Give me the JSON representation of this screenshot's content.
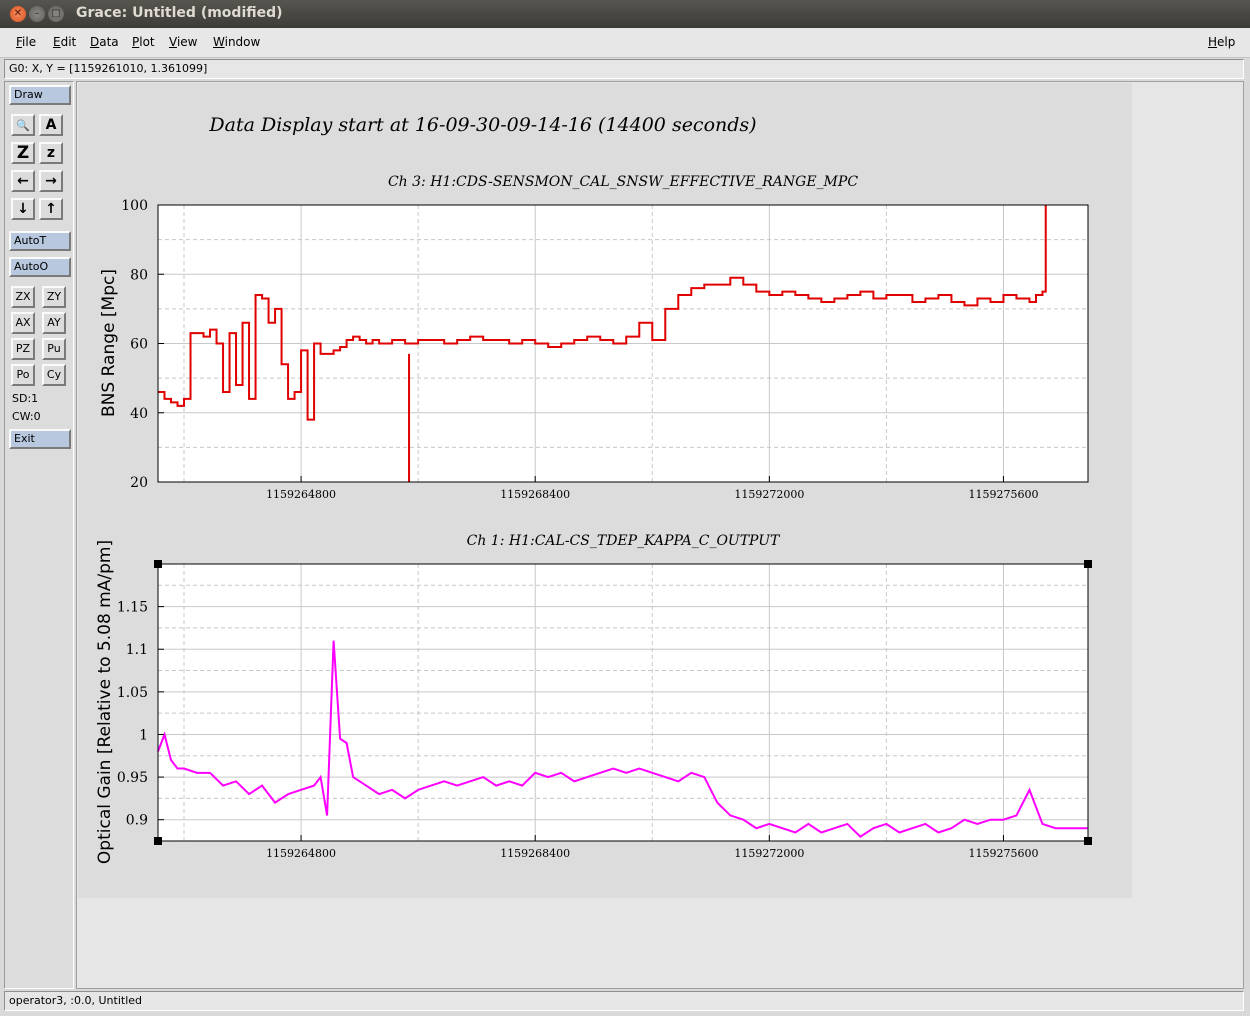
{
  "window": {
    "title": "Grace: Untitled (modified)",
    "close_glyph": "✕",
    "min_glyph": "–",
    "max_glyph": "□"
  },
  "menu": {
    "file": "File",
    "edit": "Edit",
    "data": "Data",
    "plot": "Plot",
    "view": "View",
    "window": "Window",
    "help": "Help"
  },
  "locator": {
    "text": "G0: X, Y = [1159261010, 1.361099]"
  },
  "toolbar": {
    "draw": "Draw",
    "icons": [
      "zoom-icon",
      "text-icon",
      "zoom-x-icon",
      "zoom-y-icon",
      "arrow-left-icon",
      "arrow-right-icon",
      "arrow-down-icon",
      "arrow-up-icon"
    ],
    "icon_glyphs": [
      "🔍",
      "A",
      "Z",
      "z",
      "←",
      "→",
      "↓",
      "↑"
    ],
    "autot": "AutoT",
    "autoo": "AutoO",
    "zx": "ZX",
    "zy": "ZY",
    "ax": "AX",
    "ay": "AY",
    "pz": "PZ",
    "pu": "Pu",
    "po": "Po",
    "cy": "Cy",
    "sd": "SD:1",
    "cw": "CW:0",
    "exit": "Exit"
  },
  "statusbar": {
    "text": "operator3, :0.0, Untitled"
  },
  "colors": {
    "series_range": "#e00000",
    "series_gain": "#ff00ff",
    "grid": "#c8c8c8"
  },
  "chart_data": [
    {
      "type": "line",
      "title": "Data Display start at 16-09-30-09-14-16 (14400 seconds)",
      "subtitle": "Ch 3: H1:CDS-SENSMON_CAL_SNSW_EFFECTIVE_RANGE_MPC",
      "ylabel": "BNS Range [Mpc]",
      "xlabel": "",
      "xlim": [
        1159262600,
        1159276900
      ],
      "ylim": [
        20,
        100
      ],
      "yticks": [
        20,
        40,
        60,
        80,
        100
      ],
      "xticks": [
        1159264800,
        1159268400,
        1159272000,
        1159275600
      ],
      "xtick_labels": [
        "1159264800",
        "1159268400",
        "1159272000",
        "1159275600"
      ],
      "ytick_labels": [
        "20",
        "40",
        "60",
        "80",
        "100"
      ],
      "grid": true,
      "step": true,
      "x": [
        1159262600,
        1159262700,
        1159262800,
        1159262900,
        1159263000,
        1159263100,
        1159263200,
        1159263300,
        1159263400,
        1159263500,
        1159263600,
        1159263700,
        1159263800,
        1159263900,
        1159264000,
        1159264100,
        1159264200,
        1159264300,
        1159264400,
        1159264500,
        1159264600,
        1159264700,
        1159264800,
        1159264900,
        1159265000,
        1159265100,
        1159265200,
        1159265300,
        1159265400,
        1159265500,
        1159265600,
        1159265700,
        1159265800,
        1159265900,
        1159266000,
        1159266200,
        1159266400,
        1159266600,
        1159266800,
        1159267000,
        1159267200,
        1159267400,
        1159267600,
        1159267800,
        1159268000,
        1159268200,
        1159268400,
        1159268600,
        1159268800,
        1159269000,
        1159269200,
        1159269400,
        1159269600,
        1159269800,
        1159270000,
        1159270200,
        1159270400,
        1159270600,
        1159270800,
        1159271000,
        1159271200,
        1159271400,
        1159271600,
        1159271800,
        1159272000,
        1159272200,
        1159272400,
        1159272600,
        1159272800,
        1159273000,
        1159273200,
        1159273400,
        1159273600,
        1159273800,
        1159274000,
        1159274200,
        1159274400,
        1159274600,
        1159274800,
        1159275000,
        1159275200,
        1159275400,
        1159275600,
        1159275800,
        1159276000,
        1159276100,
        1159276200,
        1159276250
      ],
      "values": [
        46,
        44,
        43,
        42,
        44,
        63,
        63,
        62,
        64,
        60,
        46,
        63,
        48,
        66,
        44,
        74,
        73,
        66,
        70,
        54,
        44,
        46,
        58,
        38,
        60,
        57,
        57,
        58,
        59,
        61,
        62,
        61,
        60,
        61,
        60,
        61,
        60,
        61,
        61,
        60,
        61,
        62,
        61,
        61,
        60,
        61,
        60,
        59,
        60,
        61,
        62,
        61,
        60,
        62,
        66,
        61,
        70,
        74,
        76,
        77,
        77,
        79,
        77,
        75,
        74,
        75,
        74,
        73,
        72,
        73,
        74,
        75,
        73,
        74,
        74,
        72,
        73,
        74,
        72,
        71,
        73,
        72,
        74,
        73,
        72,
        74,
        75,
        100
      ]
    },
    {
      "type": "line",
      "subtitle": "Ch 1: H1:CAL-CS_TDEP_KAPPA_C_OUTPUT",
      "ylabel": "Optical Gain [Relative to 5.08 mA/pm]",
      "xlabel": "",
      "xlim": [
        1159262600,
        1159276900
      ],
      "ylim": [
        0.875,
        1.2
      ],
      "yticks": [
        0.9,
        0.95,
        1,
        1.05,
        1.1,
        1.15
      ],
      "ytick_labels": [
        "0.9",
        "0.95",
        "1",
        "1.05",
        "1.1",
        "1.15"
      ],
      "xticks": [
        1159264800,
        1159268400,
        1159272000,
        1159275600
      ],
      "xtick_labels": [
        "1159264800",
        "1159268400",
        "1159272000",
        "1159275600"
      ],
      "grid": true,
      "x": [
        1159262600,
        1159262700,
        1159262800,
        1159262900,
        1159263000,
        1159263200,
        1159263400,
        1159263600,
        1159263800,
        1159264000,
        1159264200,
        1159264400,
        1159264600,
        1159264800,
        1159265000,
        1159265100,
        1159265200,
        1159265300,
        1159265400,
        1159265500,
        1159265600,
        1159265800,
        1159266000,
        1159266200,
        1159266400,
        1159266600,
        1159266800,
        1159267000,
        1159267200,
        1159267400,
        1159267600,
        1159267800,
        1159268000,
        1159268200,
        1159268400,
        1159268600,
        1159268800,
        1159269000,
        1159269200,
        1159269400,
        1159269600,
        1159269800,
        1159270000,
        1159270200,
        1159270400,
        1159270600,
        1159270800,
        1159271000,
        1159271200,
        1159271400,
        1159271600,
        1159271800,
        1159272000,
        1159272200,
        1159272400,
        1159272600,
        1159272800,
        1159273000,
        1159273200,
        1159273400,
        1159273600,
        1159273800,
        1159274000,
        1159274200,
        1159274400,
        1159274600,
        1159274800,
        1159275000,
        1159275200,
        1159275400,
        1159275600,
        1159275800,
        1159276000,
        1159276200,
        1159276400,
        1159276600,
        1159276900
      ],
      "values": [
        0.98,
        1.0,
        0.97,
        0.96,
        0.96,
        0.955,
        0.955,
        0.94,
        0.945,
        0.93,
        0.94,
        0.92,
        0.93,
        0.935,
        0.94,
        0.95,
        0.905,
        1.11,
        0.995,
        0.99,
        0.95,
        0.94,
        0.93,
        0.935,
        0.925,
        0.935,
        0.94,
        0.945,
        0.94,
        0.945,
        0.95,
        0.94,
        0.945,
        0.94,
        0.955,
        0.95,
        0.955,
        0.945,
        0.95,
        0.955,
        0.96,
        0.955,
        0.96,
        0.955,
        0.95,
        0.945,
        0.955,
        0.95,
        0.92,
        0.905,
        0.9,
        0.89,
        0.895,
        0.89,
        0.885,
        0.895,
        0.885,
        0.89,
        0.895,
        0.88,
        0.89,
        0.895,
        0.885,
        0.89,
        0.895,
        0.885,
        0.89,
        0.9,
        0.895,
        0.9,
        0.9,
        0.905,
        0.935,
        0.895,
        0.89,
        0.89,
        0.89
      ]
    }
  ]
}
